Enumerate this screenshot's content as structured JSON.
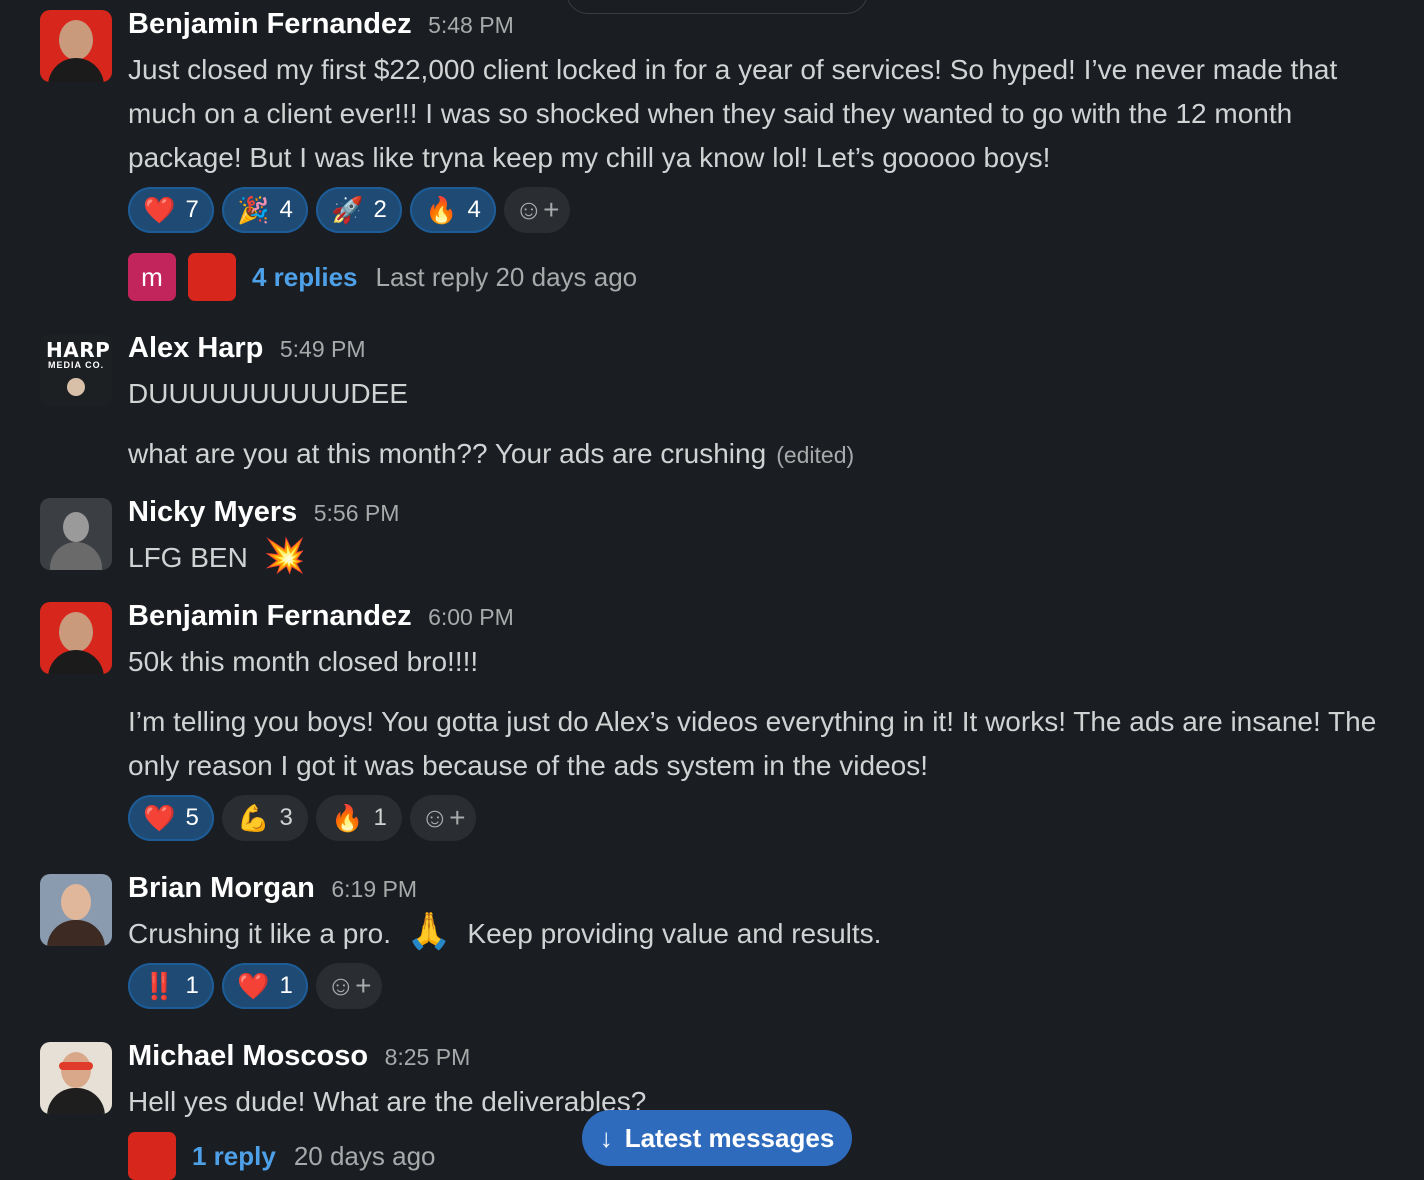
{
  "messages": [
    {
      "author": "Benjamin Fernandez",
      "time": "5:48 PM",
      "text": "Just closed my first $22,000 client locked in for a year of services! So hyped! I’ve never made that much on a client ever!!! I was so shocked when they said they wanted to go with the 12 month package! But I was like tryna keep my chill ya know lol! Let’s gooooo boys!",
      "reactions": [
        {
          "emoji": "❤️",
          "count": "7"
        },
        {
          "emoji": "🎉",
          "count": "4"
        },
        {
          "emoji": "🚀",
          "count": "2"
        },
        {
          "emoji": "🔥",
          "count": "4"
        }
      ],
      "thread": {
        "mini_avatar_letter": "m",
        "replies": "4 replies",
        "last": "Last reply 20 days ago"
      }
    },
    {
      "author": "Alex Harp",
      "time": "5:49 PM",
      "avatar_logo": "HARP",
      "avatar_logo_sub": "MEDIA CO.",
      "text": "DUUUUUUUUUUDEE",
      "text2": "what are you at this month?? Your ads are crushing",
      "edited": "(edited)"
    },
    {
      "author": "Nicky Myers",
      "time": "5:56 PM",
      "text": "LFG BEN",
      "emoji": "💥"
    },
    {
      "author": "Benjamin Fernandez",
      "time": "6:00 PM",
      "text": "50k this month closed bro!!!!",
      "text2": "I’m telling you boys! You gotta just do Alex’s videos everything in it! It works! The ads are insane! The only reason I got it was because of the ads system in the videos!",
      "reactions": [
        {
          "emoji": "❤️",
          "count": "5"
        },
        {
          "emoji": "💪",
          "count": "3"
        },
        {
          "emoji": "🔥",
          "count": "1"
        }
      ]
    },
    {
      "author": "Brian Morgan",
      "time": "6:19 PM",
      "text_a": "Crushing it like a pro.",
      "emoji": "🙏",
      "text_b": "Keep providing value and results.",
      "reactions": [
        {
          "emoji": "‼️",
          "count": "1"
        },
        {
          "emoji": "❤️",
          "count": "1"
        }
      ]
    },
    {
      "author": "Michael Moscoso",
      "time": "8:25 PM",
      "text": "Hell yes dude! What are the deliverables?",
      "thread": {
        "replies": "1 reply",
        "last": "20 days ago"
      }
    }
  ],
  "latest_button": {
    "arrow": "↓",
    "label": "Latest messages"
  },
  "icons": {
    "add_reaction": "☺+"
  },
  "colors": {
    "background": "#1a1d21",
    "link": "#4ea1e8",
    "accent": "#2f6bbd"
  }
}
